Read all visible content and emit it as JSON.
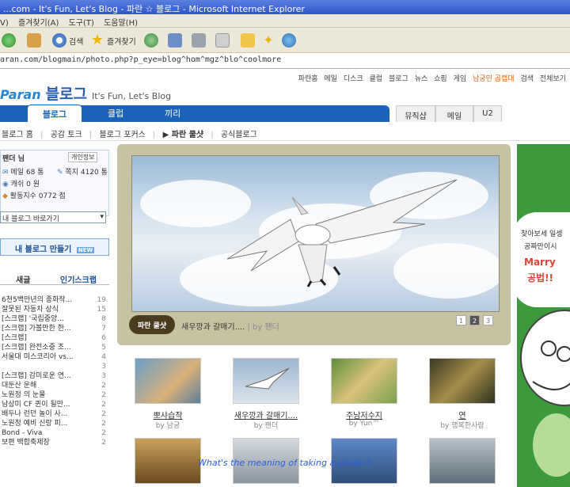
{
  "window": {
    "title": "...com - It's Fun, Let's Blog - 파란 ☆ 블로그 - Microsoft Internet Explorer"
  },
  "menu": {
    "items": [
      "V)",
      "즐겨찾기(A)",
      "도구(T)",
      "도움말(H)"
    ]
  },
  "toolbar": {
    "search_label": "검색",
    "favorites_label": "즐겨찾기"
  },
  "address": {
    "url": "aran.com/blogmain/photo.php?p_eye=blog^hom^mgz^blo^coolmore"
  },
  "topnav": {
    "items": [
      "파란홈",
      "메일",
      "디스크",
      "클럽",
      "블로그",
      "뉴스",
      "쇼핑",
      "게임",
      "남궁민 곰캡대",
      "검색",
      "전체보기"
    ]
  },
  "logo": {
    "brand": "Paran",
    "blog": "블로그",
    "tagline": "It's Fun, Let's Blog"
  },
  "tabs": {
    "blog": "블로그",
    "club": "클럽",
    "kkiri": "끼리",
    "music": "뮤직샵",
    "mail": "메일",
    "u2": "U2"
  },
  "subnav": {
    "items": [
      "블로그 홈",
      "공감 토크",
      "블로그 포커스",
      "▶ 파란 쿨샷",
      "공식블로그"
    ]
  },
  "profile": {
    "name": "팬더 님",
    "info_link": "개인정보",
    "mail_label": "메일 68 통",
    "note_label": "쪽지 4120 통",
    "cash_label": "캐쉬 0 원",
    "activity_label": "활동지수 0772 점",
    "shortcut_select": "내 블로그 바로가기",
    "make_button": "내 블로그 만들기",
    "make_badge": "NEW"
  },
  "sidebar_tabs": {
    "new": "새글",
    "popular": "인기스크랩"
  },
  "ranking": [
    {
      "title": "6천5백만년의 종화작...",
      "count": "19"
    },
    {
      "title": "잘못된 자동차 상식",
      "count": "15"
    },
    {
      "title": "[스크랩] '국립중앙...",
      "count": "8"
    },
    {
      "title": "[스크랩] 가볼만한 한...",
      "count": "7"
    },
    {
      "title": "[스크랩]",
      "count": "6"
    },
    {
      "title": "[스크랩] 완전소중 조...",
      "count": "5"
    },
    {
      "title": "서울대 미스코리아 vs...",
      "count": "4"
    },
    {
      "title": "",
      "count": "3"
    },
    {
      "title": "[스크랩] 감미로운 연...",
      "count": "3"
    },
    {
      "title": "대둔산 운해",
      "count": "2"
    },
    {
      "title": "노원정 의 눈물",
      "count": "2"
    },
    {
      "title": "남상미 CF 퀸이 될만...",
      "count": "2"
    },
    {
      "title": "배두나 런던 놀이 사...",
      "count": "2"
    },
    {
      "title": "노원정 예비 신랑 피...",
      "count": "2"
    },
    {
      "title": "Bond - Viva",
      "count": "2"
    },
    {
      "title": "보편 백합축제장",
      "count": "2"
    }
  ],
  "featured": {
    "badge": "파란 쿨샷",
    "caption": "새우깡과 갈매기....",
    "author": "| by 팬더",
    "pages": [
      "1",
      "2",
      "3"
    ],
    "active_page": 2
  },
  "ad": {
    "line1": "찾아보세 일셍",
    "line2": "공짜만이시",
    "line3": "Marry",
    "line4": "공법!!"
  },
  "thumbnails": [
    {
      "title": "뽀샤습작",
      "author": "by 남궁"
    },
    {
      "title": "새우깡과 갈매기....",
      "author": "by 팬더"
    },
    {
      "title": "주남저수지",
      "author": "by Yun™"
    },
    {
      "title": "연",
      "author": "by 행복한사람"
    }
  ],
  "overlay_text": "What's the meaning of taking a photo ?"
}
